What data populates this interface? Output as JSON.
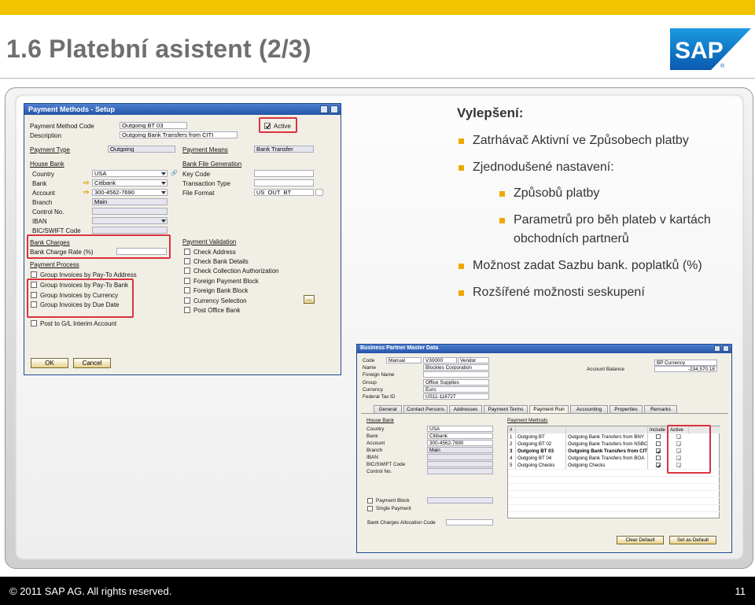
{
  "slide": {
    "title": "1.6   Platební asistent (2/3)",
    "logo_text": "SAP",
    "footer_copyright": "©  2011 SAP AG. All rights reserved.",
    "page_number": "11",
    "colors": {
      "top_bar": "#f3c300",
      "bullet": "#f0a800",
      "highlight": "#d9333f",
      "title_bar": "#2454a8"
    }
  },
  "bullets": {
    "heading": "Vylepšení:",
    "b1": "Zatrhávač  Aktivní  ve Způsobech platby",
    "b2": "Zjednodušené nastavení:",
    "b2a": "Způsobů platby",
    "b2b_line1": "Parametrů pro běh plateb v kartách",
    "b2b_line2": "obchodních partnerů",
    "b3": "Možnost zadat Sazbu bank. poplatků (%)",
    "b4": "Rozšířené možnosti seskupení"
  },
  "payment_methods": {
    "title": "Payment Methods - Setup",
    "code_label": "Payment Method Code",
    "code_value": "Outgoing BT 03",
    "active_label": "Active",
    "desc_label": "Description",
    "desc_value": "Outgoing Bank Transfers from CITI",
    "type_label": "Payment Type",
    "type_value": "Outgoing",
    "means_label": "Payment Means",
    "means_value": "Bank Transfer",
    "house_bank": "House Bank",
    "country_label": "Country",
    "country_value": "USA",
    "bank_label": "Bank",
    "bank_value": "Citibank",
    "account_label": "Account",
    "account_value": "300-4562-7690",
    "branch_label": "Branch",
    "branch_value": "Main",
    "control_label": "Control No.",
    "iban_label": "IBAN",
    "bic_label": "BIC/SWIFT Code",
    "bank_charges": "Bank Charges",
    "charge_rate_label": "Bank Charge Rate (%)",
    "bfg_label": "Bank File Generation",
    "key_code_label": "Key Code",
    "trans_type_label": "Transaction Type",
    "file_format_label": "File Format",
    "file_format_value": "US_OUT_BT",
    "payment_process": "Payment Process",
    "grp_payto_addr": "Group Invoices by Pay-To Address",
    "grp_payto_bank": "Group Invoices by Pay-To Bank",
    "grp_currency": "Group Invoices by Currency",
    "grp_due_date": "Group Invoices by Due Date",
    "post_gl": "Post to G/L Interim Account",
    "payment_validation": "Payment Validation",
    "check_address": "Check Address",
    "check_bank": "Check Bank Details",
    "check_collection": "Check Collection Authorization",
    "foreign_block": "Foreign Payment Block",
    "foreign_bank": "Foreign Bank Block",
    "currency_selection": "Currency Selection",
    "post_office": "Post Office Bank",
    "ellipsis": "...",
    "ok": "OK",
    "cancel": "Cancel"
  },
  "bp": {
    "title": "Business Partner Master Data",
    "code_label": "Code",
    "code_mode": "Manual",
    "code_value": "V30000",
    "code_type": "Vendor",
    "name_label": "Name",
    "name_value": "Blockies Corporation",
    "foreign_label": "Foreign Name",
    "group_label": "Group",
    "group_value": "Office Supplies",
    "currency_label": "Currency",
    "currency_value": "Euro",
    "taxid_label": "Federal Tax ID",
    "taxid_value": "US11-116727",
    "balance_label": "Account Balance",
    "bp_currency": "BP Currency",
    "balance_value": "-234,570.18",
    "tabs": [
      "General",
      "Contact Persons",
      "Addresses",
      "Payment Terms",
      "Payment Run",
      "Accounting",
      "Properties",
      "Remarks"
    ],
    "house_bank": "House Bank",
    "country_label": "Country",
    "country_value": "USA",
    "bank_label": "Bank",
    "bank_value": "Citibank",
    "account_label": "Account",
    "account_value": "300-4562-7690",
    "branch_label": "Branch",
    "branch_value": "Main",
    "iban_label": "IBAN",
    "bic_label": "BIC/SWIFT Code",
    "control_label": "Control No.",
    "payment_methods": "Payment Methods",
    "col_hash": "#",
    "col_include": "Include",
    "col_active": "Active",
    "rows": [
      {
        "n": "1",
        "code": "Outgoing BT",
        "desc": "Outgoing Bank Transfers from BNY",
        "include": false,
        "bold": false
      },
      {
        "n": "2",
        "code": "Outgoing BT 02",
        "desc": "Outgoing Bank Transfers from NSBC",
        "include": false,
        "bold": false
      },
      {
        "n": "3",
        "code": "Outgoing BT 03",
        "desc": "Outgoing Bank Transfers from CITI",
        "include": true,
        "bold": true
      },
      {
        "n": "4",
        "code": "Outgoing BT 04",
        "desc": "Outgoing Bank Transfers from BOA",
        "include": false,
        "bold": false
      },
      {
        "n": "5",
        "code": "Outgoing Checks",
        "desc": "Outgoing Checks",
        "include": true,
        "bold": false
      }
    ],
    "payment_block": "Payment Block",
    "single_payment": "Single Payment",
    "alloc_label": "Bank Charges Allocation Code",
    "clear_default": "Clear Default",
    "set_default": "Set as Default"
  }
}
